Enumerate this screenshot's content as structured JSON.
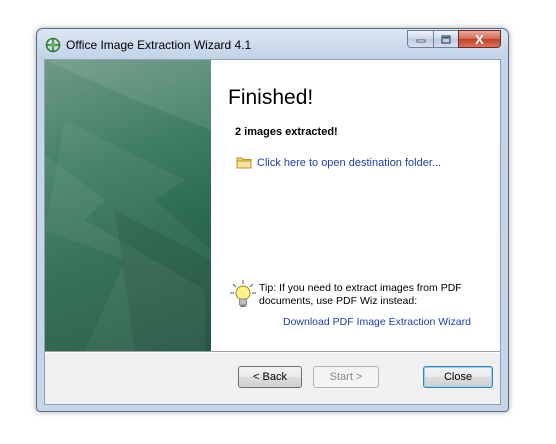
{
  "window": {
    "title": "Office Image Extraction Wizard 4.1",
    "close_glyph": "X"
  },
  "content": {
    "heading": "Finished!",
    "result": "2 images extracted!",
    "open_folder_link": "Click here to open destination folder...",
    "tip_text": "Tip: If you need to extract images from PDF documents, use PDF Wiz instead:",
    "download_link": "Download PDF Image Extraction Wizard"
  },
  "buttons": {
    "back": "< Back",
    "start": "Start >",
    "close": "Close"
  },
  "icons": {
    "app": "green-grid-icon",
    "folder": "folder-icon",
    "tip": "lightbulb-icon"
  },
  "colors": {
    "link": "#1b3fa8",
    "sidebar_green": "#2d6b51"
  }
}
